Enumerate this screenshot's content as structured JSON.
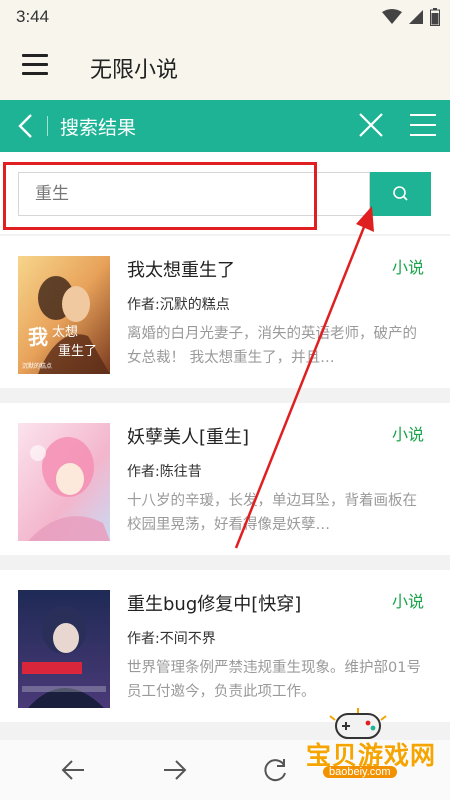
{
  "status_bar": {
    "time": "3:44"
  },
  "app_bar": {
    "title": "无限小说"
  },
  "search_header": {
    "title": "搜索结果"
  },
  "search": {
    "value": "重生"
  },
  "results": [
    {
      "title": "我太想重生了",
      "tag": "小说",
      "author": "作者:沉默的糕点",
      "description": "离婚的白月光妻子，消失的英语老师，破产的女总裁！ 我太想重生了，并且…",
      "cover_text": "我太想重生了",
      "cover_author": "沉默的糕点"
    },
    {
      "title": "妖孽美人[重生]",
      "tag": "小说",
      "author": "作者:陈往昔",
      "description": "十八岁的辛瑗，长发，单边耳坠，背着画板在校园里晃荡，好看得像是妖孽…"
    },
    {
      "title": "重生bug修复中[快穿]",
      "tag": "小说",
      "author": "作者:不间不界",
      "description": "世界管理条例严禁违规重生现象。维护部01号员工付邀今，负责此项工作。"
    }
  ],
  "watermark": {
    "text": "宝贝游戏网",
    "url": "baobeiy.com"
  },
  "colors": {
    "accent": "#1db394",
    "tag": "#1aa34a",
    "highlight": "#e02020",
    "watermark": "#f5a400"
  },
  "icons": [
    "menu-icon",
    "back-chevron-icon",
    "close-icon",
    "list-menu-icon",
    "search-icon",
    "arrow-left-icon",
    "arrow-right-icon",
    "refresh-icon",
    "wifi-icon",
    "signal-icon",
    "battery-icon"
  ]
}
